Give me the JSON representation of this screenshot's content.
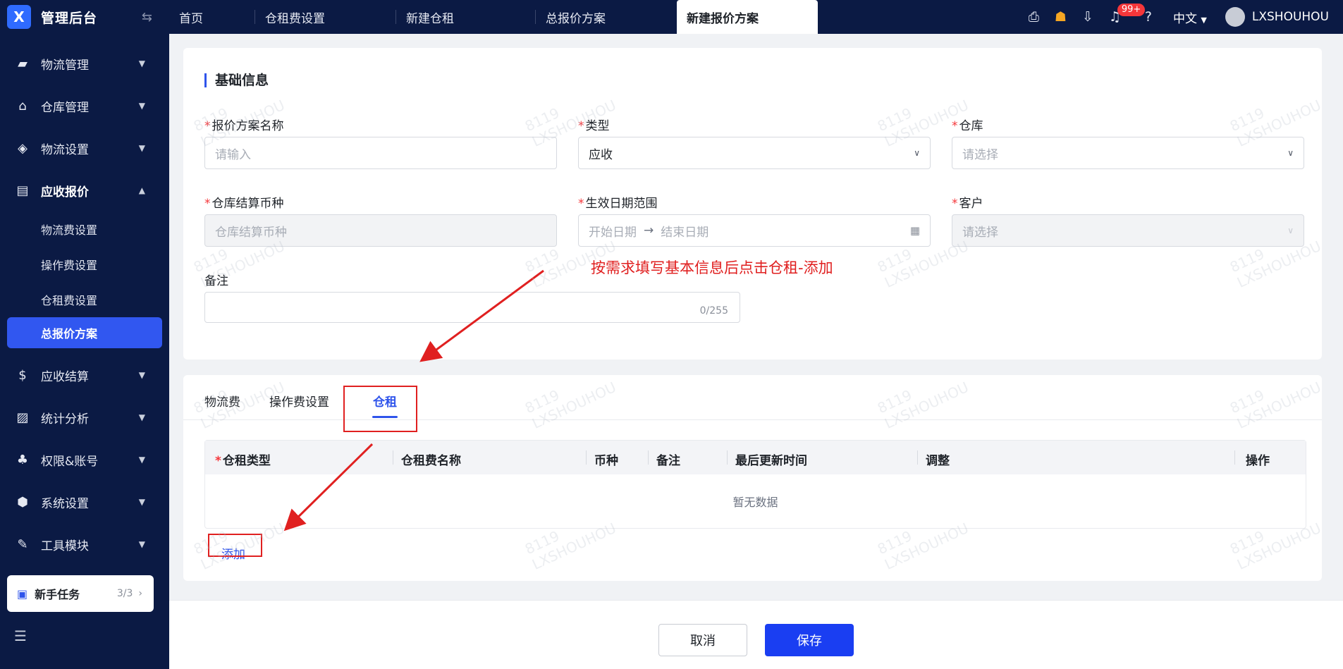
{
  "app": {
    "title": "管理后台"
  },
  "tabs": [
    {
      "label": "首页"
    },
    {
      "label": "仓租费设置"
    },
    {
      "label": "新建仓租"
    },
    {
      "label": "总报价方案"
    },
    {
      "label": "新建报价方案"
    }
  ],
  "header": {
    "notification_count": "99+",
    "language": "中文",
    "username": "LXSHOUHOU"
  },
  "sidebar": {
    "items": [
      {
        "label": "物流管理"
      },
      {
        "label": "仓库管理"
      },
      {
        "label": "物流设置"
      },
      {
        "label": "应收报价"
      },
      {
        "label": "应收结算"
      },
      {
        "label": "统计分析"
      },
      {
        "label": "权限&账号"
      },
      {
        "label": "系统设置"
      },
      {
        "label": "工具模块"
      }
    ],
    "sub_items": [
      {
        "label": "物流费设置"
      },
      {
        "label": "操作费设置"
      },
      {
        "label": "仓租费设置"
      },
      {
        "label": "总报价方案"
      }
    ],
    "task": {
      "label": "新手任务",
      "count": "3/3"
    }
  },
  "form": {
    "section_title": "基础信息",
    "plan_name": {
      "label": "报价方案名称",
      "placeholder": "请输入"
    },
    "type": {
      "label": "类型",
      "value": "应收"
    },
    "warehouse": {
      "label": "仓库",
      "placeholder": "请选择"
    },
    "currency": {
      "label": "仓库结算币种",
      "placeholder": "仓库结算币种"
    },
    "date_range": {
      "label": "生效日期范围",
      "start_placeholder": "开始日期",
      "end_placeholder": "结束日期"
    },
    "customer": {
      "label": "客户",
      "placeholder": "请选择"
    },
    "remark": {
      "label": "备注",
      "count": "0/255"
    }
  },
  "annotation": {
    "text": "按需求填写基本信息后点击仓租-添加"
  },
  "inner_tabs": [
    {
      "label": "物流费"
    },
    {
      "label": "操作费设置"
    },
    {
      "label": "仓租"
    }
  ],
  "table": {
    "columns": [
      "仓租类型",
      "仓租费名称",
      "币种",
      "备注",
      "最后更新时间",
      "调整",
      "操作"
    ],
    "empty_text": "暂无数据",
    "add_label": "添加"
  },
  "footer": {
    "cancel_label": "取消",
    "save_label": "保存"
  },
  "watermark": {
    "line1": "8119",
    "line2": "LXSHOUHOU"
  },
  "colors": {
    "primary": "#2f54eb",
    "nav_bg": "#0b1a44",
    "annotation": "#e02020",
    "save_button": "#1a3ef2"
  }
}
